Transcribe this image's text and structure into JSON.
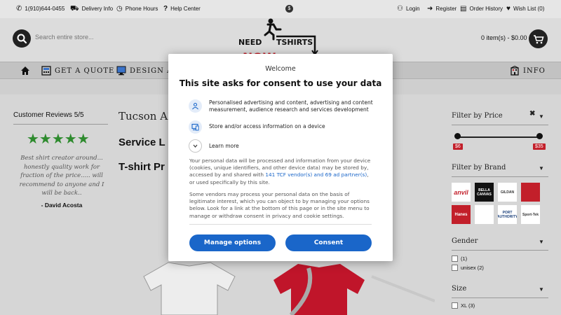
{
  "topbar": {
    "phone": "1(910)644-0455",
    "delivery": "Delivery Info",
    "hours": "Phone Hours",
    "help": "Help Center",
    "currency": "$",
    "login": "Login",
    "register": "Register",
    "order_history": "Order History",
    "wishlist": "Wish List (0)"
  },
  "header": {
    "search_placeholder": "Search entire store...",
    "logo_line1_a": "NEED",
    "logo_line1_b": "TSHIRTS",
    "logo_line2": "NOW",
    "cart": "0 item(s) - $0.00"
  },
  "nav": {
    "quote": "GET A QUOTE",
    "design": "DESIGN A T",
    "info": "INFO"
  },
  "reviews": {
    "title": "Customer Reviews 5/5",
    "stars": "★★★★★",
    "text": "Best shirt creator around... honestly quality work for fraction of the price..... will recommend to anyone and I will be back..",
    "author": "- David Acosta"
  },
  "main": {
    "title": "Tucson AZ",
    "heading1": "Service L",
    "heading2": "T-shirt Pr"
  },
  "filters": {
    "price_title": "Filter by Price",
    "price_min": "$6",
    "price_max": "$35",
    "brand_title": "Filter by Brand",
    "brands": [
      "anvil",
      "BELLA CANVAS",
      "GILDAN",
      "",
      "Hanes",
      "",
      "PORT AUTHORITY",
      "Sport-Tek"
    ],
    "gender_title": "Gender",
    "gender_options": [
      {
        "label": "(1)"
      },
      {
        "label": "unisex (2)"
      }
    ],
    "size_title": "Size",
    "size_options": [
      {
        "label": "XL (3)"
      }
    ]
  },
  "modal": {
    "welcome": "Welcome",
    "title": "This site asks for consent to use your data",
    "opt1": "Personalised advertising and content, advertising and content measurement, audience research and services development",
    "opt2": "Store and/or access information on a device",
    "opt3": "Learn more",
    "para1_a": "Your personal data will be processed and information from your device (cookies, unique identifiers, and other device data) may be stored by, accessed by and shared with ",
    "para1_link": "141 TCF vendor(s) and 69 ad partner(s)",
    "para1_b": ", or used specifically by this site.",
    "para2": "Some vendors may process your personal data on the basis of legitimate interest, which you can object to by managing your options below. Look for a link at the bottom of this page or in the site menu to manage or withdraw consent in privacy and cookie settings.",
    "manage": "Manage options",
    "consent": "Consent"
  },
  "colors": {
    "accent_blue": "#1a66c9",
    "price_red": "#c21f2a",
    "star_green": "#2e8b2e"
  }
}
